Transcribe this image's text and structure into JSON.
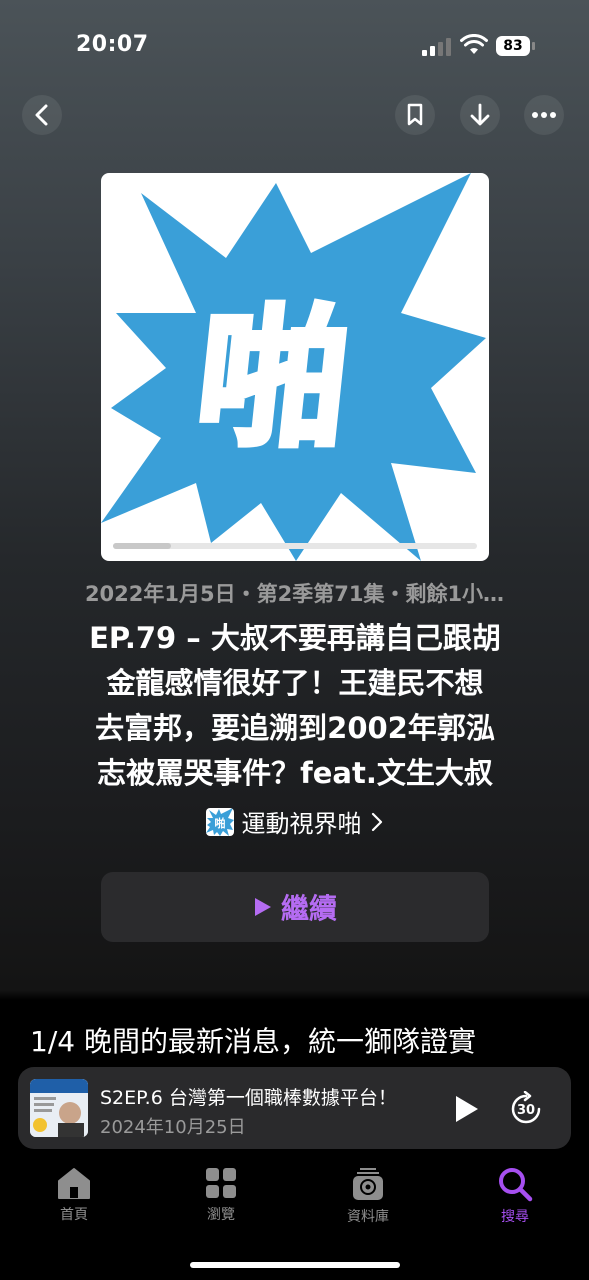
{
  "status": {
    "time": "20:07",
    "battery": "83"
  },
  "episode": {
    "meta": "2022年1月5日・第2季第71集・剩餘1小…",
    "title_lines": [
      "EP.79 – 大叔不要再講自己跟胡",
      "金龍感情很好了！王建民不想",
      "去富邦，要追溯到2002年郭泓",
      "志被罵哭事件？feat.文生大叔"
    ],
    "show_name": "運動視界啪",
    "artwork_text": "啪",
    "artwork_color": "#3a9fd8",
    "progress": 0.16,
    "continue_label": "繼續",
    "description_preview": "1/4 晚間的最新消息，統一獅隊證實"
  },
  "mini_player": {
    "title": "S2EP.6 台灣第一個職棒數據平台！",
    "date": "2024年10月25日",
    "skip_seconds": "30"
  },
  "tabs": [
    {
      "label": "首頁",
      "icon": "home-icon"
    },
    {
      "label": "瀏覽",
      "icon": "grid-icon"
    },
    {
      "label": "資料庫",
      "icon": "library-icon"
    },
    {
      "label": "搜尋",
      "icon": "search-icon",
      "active": true
    }
  ],
  "colors": {
    "accent": "#a64ff0",
    "art_blue": "#3a9fd8"
  }
}
